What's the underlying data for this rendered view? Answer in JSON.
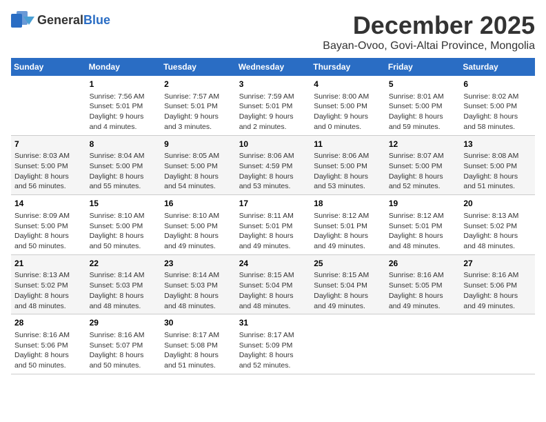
{
  "header": {
    "logo_general": "General",
    "logo_blue": "Blue",
    "title": "December 2025",
    "subtitle": "Bayan-Ovoo, Govi-Altai Province, Mongolia"
  },
  "calendar": {
    "weekdays": [
      "Sunday",
      "Monday",
      "Tuesday",
      "Wednesday",
      "Thursday",
      "Friday",
      "Saturday"
    ],
    "weeks": [
      [
        {
          "day": "",
          "text": ""
        },
        {
          "day": "1",
          "text": "Sunrise: 7:56 AM\nSunset: 5:01 PM\nDaylight: 9 hours\nand 4 minutes."
        },
        {
          "day": "2",
          "text": "Sunrise: 7:57 AM\nSunset: 5:01 PM\nDaylight: 9 hours\nand 3 minutes."
        },
        {
          "day": "3",
          "text": "Sunrise: 7:59 AM\nSunset: 5:01 PM\nDaylight: 9 hours\nand 2 minutes."
        },
        {
          "day": "4",
          "text": "Sunrise: 8:00 AM\nSunset: 5:00 PM\nDaylight: 9 hours\nand 0 minutes."
        },
        {
          "day": "5",
          "text": "Sunrise: 8:01 AM\nSunset: 5:00 PM\nDaylight: 8 hours\nand 59 minutes."
        },
        {
          "day": "6",
          "text": "Sunrise: 8:02 AM\nSunset: 5:00 PM\nDaylight: 8 hours\nand 58 minutes."
        }
      ],
      [
        {
          "day": "7",
          "text": "Sunrise: 8:03 AM\nSunset: 5:00 PM\nDaylight: 8 hours\nand 56 minutes."
        },
        {
          "day": "8",
          "text": "Sunrise: 8:04 AM\nSunset: 5:00 PM\nDaylight: 8 hours\nand 55 minutes."
        },
        {
          "day": "9",
          "text": "Sunrise: 8:05 AM\nSunset: 5:00 PM\nDaylight: 8 hours\nand 54 minutes."
        },
        {
          "day": "10",
          "text": "Sunrise: 8:06 AM\nSunset: 4:59 PM\nDaylight: 8 hours\nand 53 minutes."
        },
        {
          "day": "11",
          "text": "Sunrise: 8:06 AM\nSunset: 5:00 PM\nDaylight: 8 hours\nand 53 minutes."
        },
        {
          "day": "12",
          "text": "Sunrise: 8:07 AM\nSunset: 5:00 PM\nDaylight: 8 hours\nand 52 minutes."
        },
        {
          "day": "13",
          "text": "Sunrise: 8:08 AM\nSunset: 5:00 PM\nDaylight: 8 hours\nand 51 minutes."
        }
      ],
      [
        {
          "day": "14",
          "text": "Sunrise: 8:09 AM\nSunset: 5:00 PM\nDaylight: 8 hours\nand 50 minutes."
        },
        {
          "day": "15",
          "text": "Sunrise: 8:10 AM\nSunset: 5:00 PM\nDaylight: 8 hours\nand 50 minutes."
        },
        {
          "day": "16",
          "text": "Sunrise: 8:10 AM\nSunset: 5:00 PM\nDaylight: 8 hours\nand 49 minutes."
        },
        {
          "day": "17",
          "text": "Sunrise: 8:11 AM\nSunset: 5:01 PM\nDaylight: 8 hours\nand 49 minutes."
        },
        {
          "day": "18",
          "text": "Sunrise: 8:12 AM\nSunset: 5:01 PM\nDaylight: 8 hours\nand 49 minutes."
        },
        {
          "day": "19",
          "text": "Sunrise: 8:12 AM\nSunset: 5:01 PM\nDaylight: 8 hours\nand 48 minutes."
        },
        {
          "day": "20",
          "text": "Sunrise: 8:13 AM\nSunset: 5:02 PM\nDaylight: 8 hours\nand 48 minutes."
        }
      ],
      [
        {
          "day": "21",
          "text": "Sunrise: 8:13 AM\nSunset: 5:02 PM\nDaylight: 8 hours\nand 48 minutes."
        },
        {
          "day": "22",
          "text": "Sunrise: 8:14 AM\nSunset: 5:03 PM\nDaylight: 8 hours\nand 48 minutes."
        },
        {
          "day": "23",
          "text": "Sunrise: 8:14 AM\nSunset: 5:03 PM\nDaylight: 8 hours\nand 48 minutes."
        },
        {
          "day": "24",
          "text": "Sunrise: 8:15 AM\nSunset: 5:04 PM\nDaylight: 8 hours\nand 48 minutes."
        },
        {
          "day": "25",
          "text": "Sunrise: 8:15 AM\nSunset: 5:04 PM\nDaylight: 8 hours\nand 49 minutes."
        },
        {
          "day": "26",
          "text": "Sunrise: 8:16 AM\nSunset: 5:05 PM\nDaylight: 8 hours\nand 49 minutes."
        },
        {
          "day": "27",
          "text": "Sunrise: 8:16 AM\nSunset: 5:06 PM\nDaylight: 8 hours\nand 49 minutes."
        }
      ],
      [
        {
          "day": "28",
          "text": "Sunrise: 8:16 AM\nSunset: 5:06 PM\nDaylight: 8 hours\nand 50 minutes."
        },
        {
          "day": "29",
          "text": "Sunrise: 8:16 AM\nSunset: 5:07 PM\nDaylight: 8 hours\nand 50 minutes."
        },
        {
          "day": "30",
          "text": "Sunrise: 8:17 AM\nSunset: 5:08 PM\nDaylight: 8 hours\nand 51 minutes."
        },
        {
          "day": "31",
          "text": "Sunrise: 8:17 AM\nSunset: 5:09 PM\nDaylight: 8 hours\nand 52 minutes."
        },
        {
          "day": "",
          "text": ""
        },
        {
          "day": "",
          "text": ""
        },
        {
          "day": "",
          "text": ""
        }
      ]
    ]
  }
}
